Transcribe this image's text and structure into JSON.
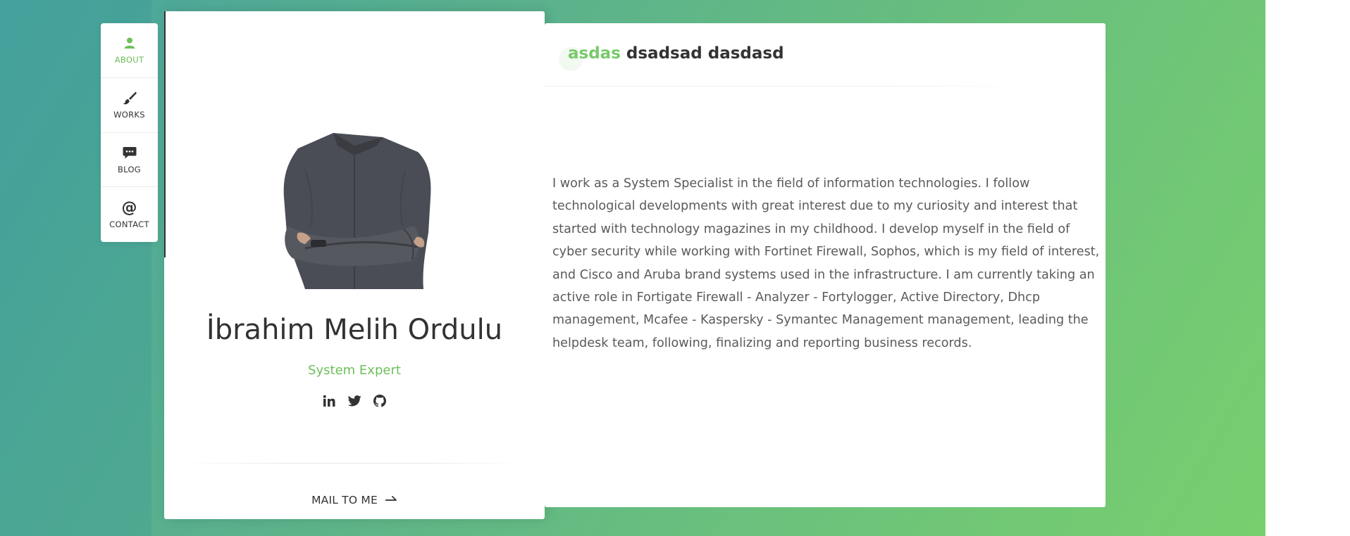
{
  "nav": {
    "items": [
      {
        "label": "ABOUT",
        "icon": "user-icon",
        "active": true
      },
      {
        "label": "WORKS",
        "icon": "brush-icon",
        "active": false
      },
      {
        "label": "BLOG",
        "icon": "chat-icon",
        "active": false
      },
      {
        "label": "CONTACT",
        "icon": "at-icon",
        "active": false
      }
    ]
  },
  "profile": {
    "name": "İbrahim Melih Ordulu",
    "role": "System Expert",
    "socials": [
      "linkedin-icon",
      "twitter-icon",
      "github-icon"
    ],
    "mail_label": "MAIL TO ME"
  },
  "about": {
    "heading_accent": "asdas",
    "heading_rest": "dsadsad dasdasd",
    "text": "I work as a System Specialist in the field of information technologies. I follow technological developments with great interest due to my curiosity and interest that started with technology magazines in my childhood. I develop myself in the field of cyber security while working with Fortinet Firewall, Sophos, which is my field of interest, and Cisco and Aruba brand systems used in the infrastructure. I am currently taking an active role in Fortigate Firewall - Analyzer - Fortylogger, Active Directory, Dhcp management, Mcafee - Kaspersky - Symantec Management management, leading the helpdesk team, following, finalizing and reporting business records."
  },
  "colors": {
    "accent": "#6dbf5a",
    "background_start": "#4aa59e",
    "background_end": "#78cf6e"
  }
}
